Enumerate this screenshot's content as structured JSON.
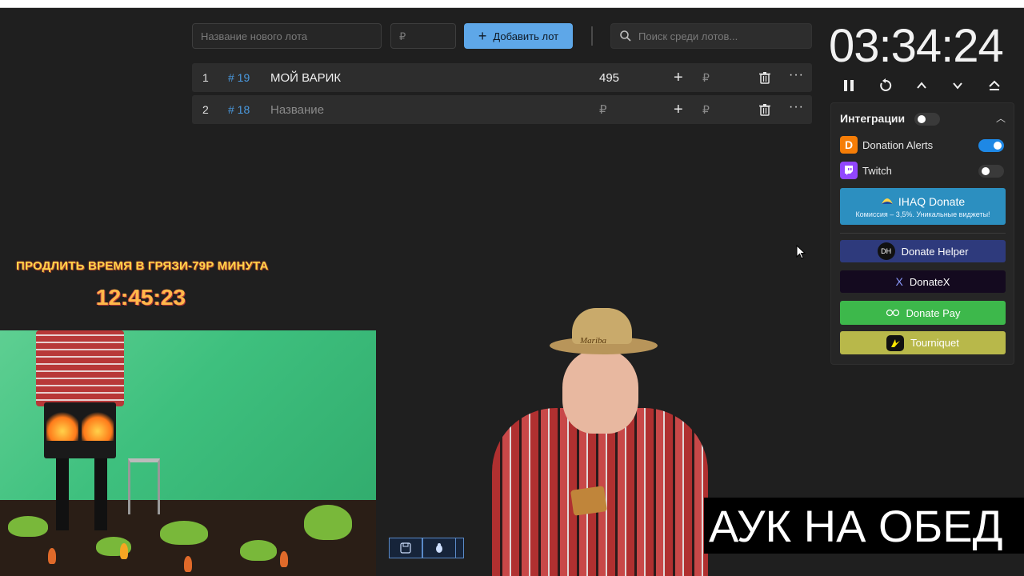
{
  "toolbar": {
    "lot_name_placeholder": "Название нового лота",
    "price_placeholder": "₽",
    "add_button_label": "Добавить лот",
    "search_placeholder": "Поиск среди лотов..."
  },
  "lots": [
    {
      "index": "1",
      "id": "# 19",
      "name": "МОЙ ВАРИК",
      "amount": "495",
      "currency": "₽"
    },
    {
      "index": "2",
      "id": "# 18",
      "name": "Название",
      "amount": "₽",
      "currency": "₽"
    }
  ],
  "timer": {
    "value": "03:34:24"
  },
  "integrations": {
    "title": "Интеграции",
    "master_enabled": false,
    "services": [
      {
        "label": "Donation Alerts",
        "enabled": true
      },
      {
        "label": "Twitch",
        "enabled": false
      }
    ],
    "ihaq": {
      "label": "IHAQ Donate",
      "subtitle": "Комиссия – 3,5%. Уникальные виджеты!"
    },
    "buttons": [
      {
        "label": "Donate Helper",
        "icon_text": "DH"
      },
      {
        "label": "DonateX",
        "icon_text": "X"
      },
      {
        "label": "Donate Pay"
      },
      {
        "label": "Tourniquet"
      }
    ]
  },
  "overlay": {
    "promo_text": "ПРОДЛИТЬ ВРЕМЯ В ГРЯЗИ-79Р МИНУТА",
    "promo_timer": "12:45:23",
    "hat_text": "Mariba",
    "ticker_text": "АУК НА ОБЕД"
  },
  "colors": {
    "accent": "#5ea7e8",
    "ihaq": "#2c8fc0",
    "donate_helper": "#2e3a7c",
    "donatex": "#140a1f",
    "donate_pay": "#3db84b",
    "tourniquet": "#b8b84a"
  }
}
